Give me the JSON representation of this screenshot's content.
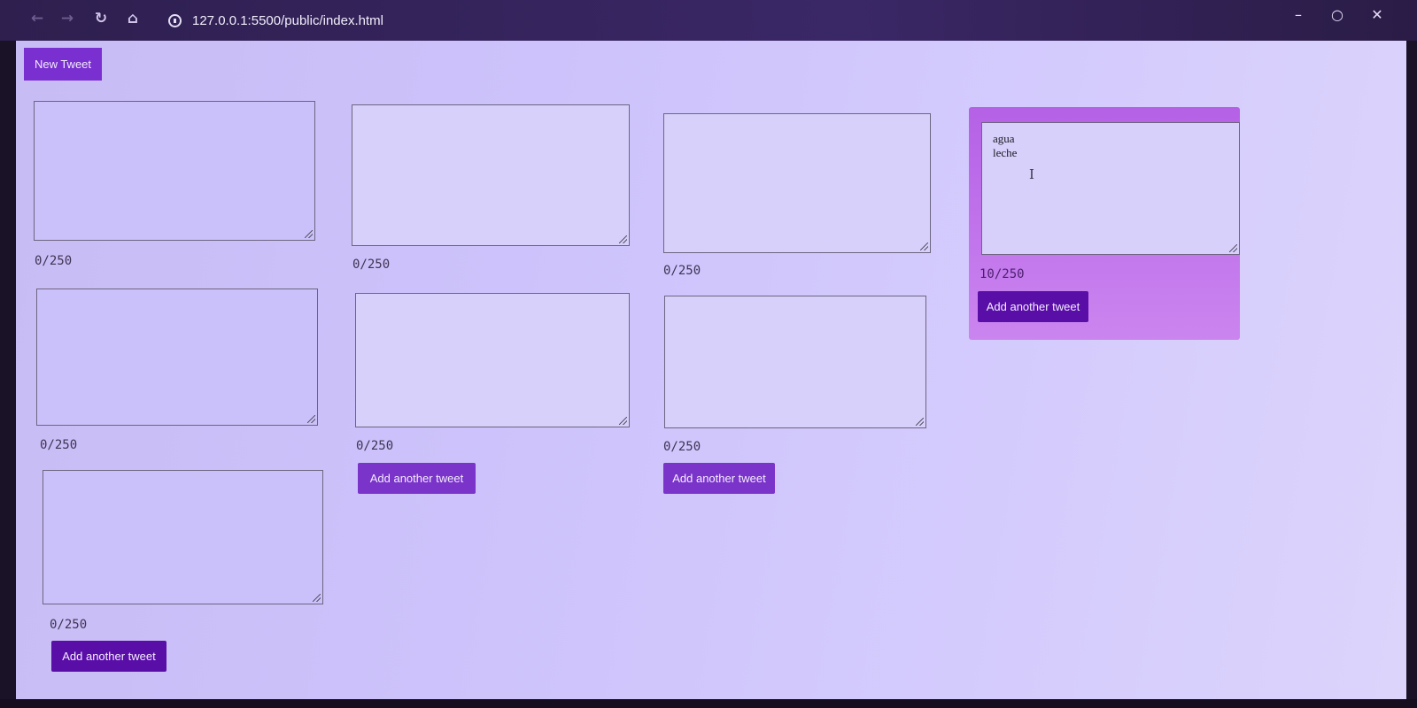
{
  "browser": {
    "url": "127.0.0.1:5500/public/index.html",
    "icons": {
      "back": "back-arrow-icon",
      "forward": "forward-arrow-icon",
      "reload": "reload-icon",
      "home": "home-icon",
      "info": "info-icon",
      "star": "bookmark-star-icon",
      "extensions": "extensions-icon",
      "media": "media-icon",
      "download": "download-icon",
      "profile": "profile-avatar-icon",
      "menu": "kebab-menu-icon",
      "minimize": "minimize-icon",
      "restore": "restore-icon",
      "close": "close-icon"
    }
  },
  "page": {
    "new_tweet_label": "New Tweet",
    "colors": {
      "accent": "#7a2fd0",
      "accent_dark": "#5a0ea8",
      "background": "#cdc2fb",
      "active_card": "#bf6de9"
    }
  },
  "tweets": [
    {
      "text": "",
      "counter": "0/250"
    },
    {
      "text": "",
      "counter": "0/250"
    },
    {
      "text": "",
      "counter": "0/250"
    },
    {
      "text": "agua\nleche",
      "counter": "10/250",
      "button": "Add another tweet",
      "active": true
    },
    {
      "text": "",
      "counter": "0/250"
    },
    {
      "text": "",
      "counter": "0/250",
      "button": "Add another tweet"
    },
    {
      "text": "",
      "counter": "0/250",
      "button": "Add another tweet"
    },
    {
      "text": "",
      "counter": "0/250",
      "button": "Add another tweet"
    }
  ]
}
